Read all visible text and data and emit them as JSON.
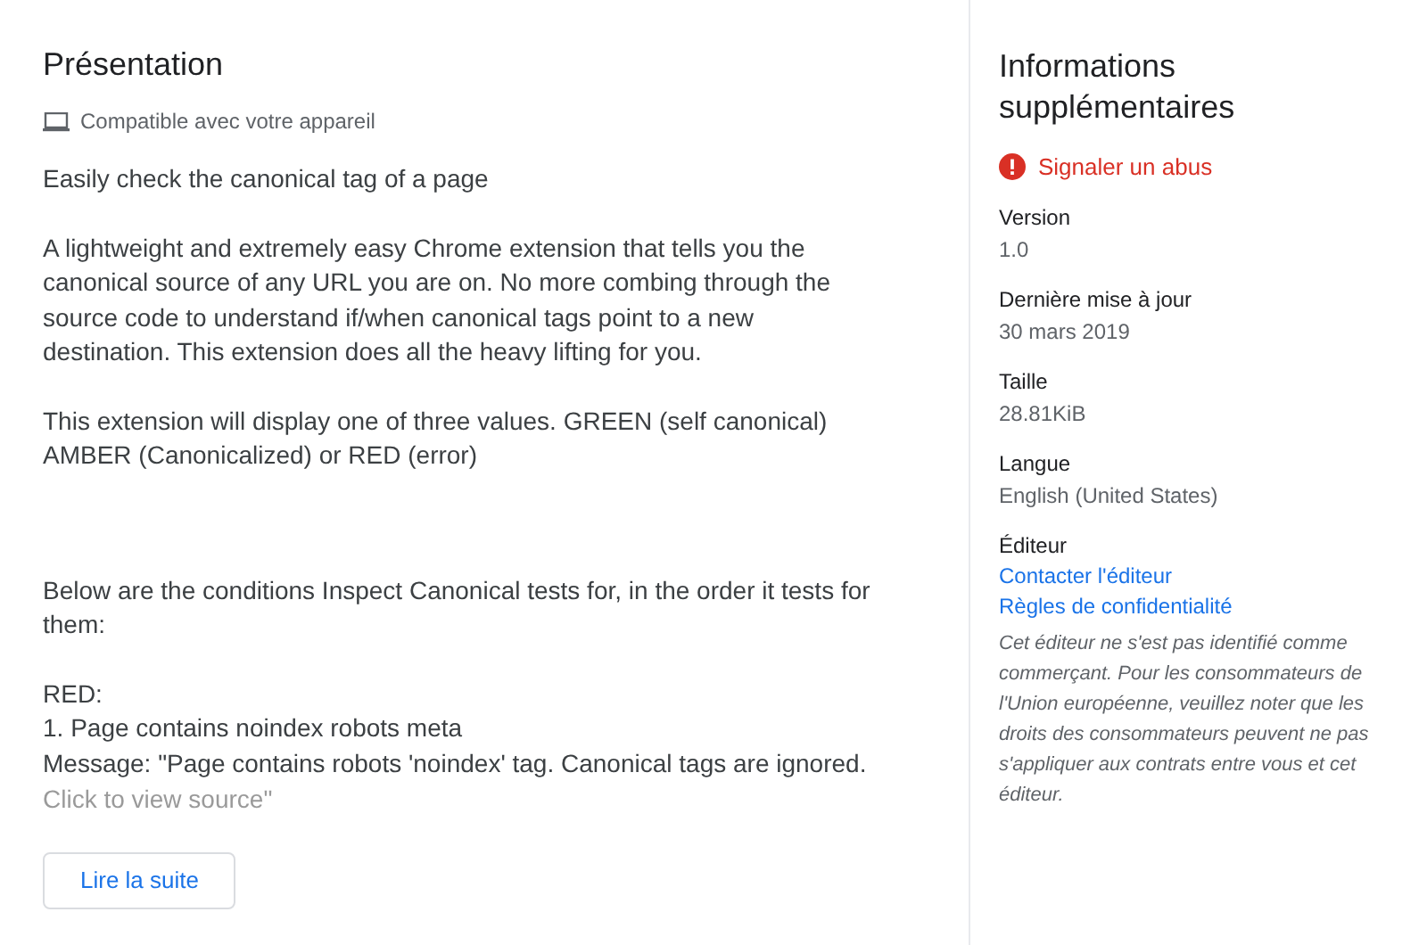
{
  "overview": {
    "title": "Présentation",
    "compatibility": "Compatible avec votre appareil",
    "paragraphs": [
      [
        "Easily check the canonical tag of a page"
      ],
      [
        "A lightweight and extremely easy Chrome extension that tells you the",
        "canonical source of any URL you are on.  No more combing through the",
        "source code to understand if/when canonical tags point to a new",
        "destination. This extension does all the heavy lifting for you."
      ],
      [
        "This extension will display one of three values. GREEN (self canonical)",
        "AMBER (Canonicalized) or RED (error)"
      ],
      [
        "Below are the conditions Inspect Canonical tests for, in the order it tests for",
        "them:"
      ],
      [
        "RED:",
        "1. Page contains noindex robots meta",
        "Message: \"Page contains robots 'noindex' tag. Canonical tags are ignored."
      ]
    ],
    "faded_line": "Click to view source\"",
    "read_more": "Lire la suite"
  },
  "additional_info": {
    "title": "Informations supplémentaires",
    "report_abuse": "Signaler un abus",
    "fields": [
      {
        "label": "Version",
        "value": "1.0"
      },
      {
        "label": "Dernière mise à jour",
        "value": "30 mars 2019"
      },
      {
        "label": "Taille",
        "value": "28.81KiB"
      },
      {
        "label": "Langue",
        "value": "English (United States)"
      }
    ],
    "publisher": {
      "label": "Éditeur",
      "links": [
        "Contacter l'éditeur",
        "Règles de confidentialité"
      ],
      "notice": "Cet éditeur ne s'est pas identifié comme commerçant. Pour les consommateurs de l'Union européenne, veuillez noter que les droits des consommateurs peuvent ne pas s'appliquer aux contrats entre vous et cet éditeur."
    }
  }
}
